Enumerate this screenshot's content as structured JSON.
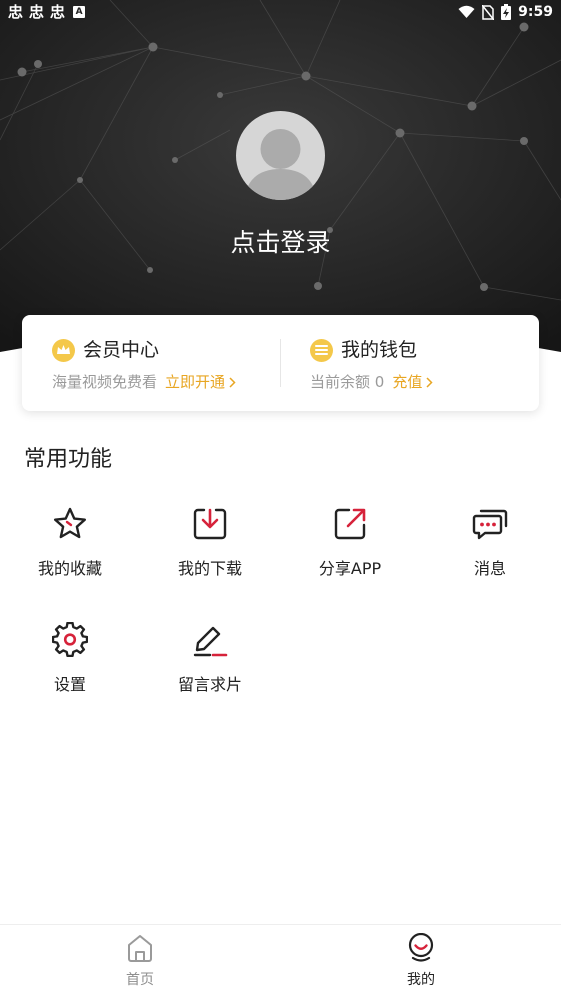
{
  "status_bar": {
    "notification_glyph": "忠",
    "a_indicator": "A",
    "time": "9:59",
    "icons": [
      "wifi-icon",
      "no-sim-icon",
      "battery-charging-icon"
    ]
  },
  "profile": {
    "login_text": "点击登录"
  },
  "member_card": {
    "vip": {
      "title": "会员中心",
      "subtitle": "海量视频免费看",
      "link": "立即开通"
    },
    "wallet": {
      "title": "我的钱包",
      "subtitle": "当前余额 0",
      "link": "充值"
    }
  },
  "functions": {
    "section_title": "常用功能",
    "items": [
      {
        "label": "我的收藏",
        "icon": "star-icon"
      },
      {
        "label": "我的下载",
        "icon": "download-icon"
      },
      {
        "label": "分享APP",
        "icon": "share-icon"
      },
      {
        "label": "消息",
        "icon": "message-icon"
      },
      {
        "label": "设置",
        "icon": "gear-icon"
      },
      {
        "label": "留言求片",
        "icon": "edit-icon"
      }
    ]
  },
  "tab_bar": {
    "tabs": [
      {
        "label": "首页",
        "icon": "home-icon",
        "active": false
      },
      {
        "label": "我的",
        "icon": "profile-icon",
        "active": true
      }
    ]
  },
  "colors": {
    "accent": "#e8a623",
    "icon_red": "#d6223a",
    "hero_dark": "#1e1e1e",
    "coin": "#f4c84a"
  }
}
